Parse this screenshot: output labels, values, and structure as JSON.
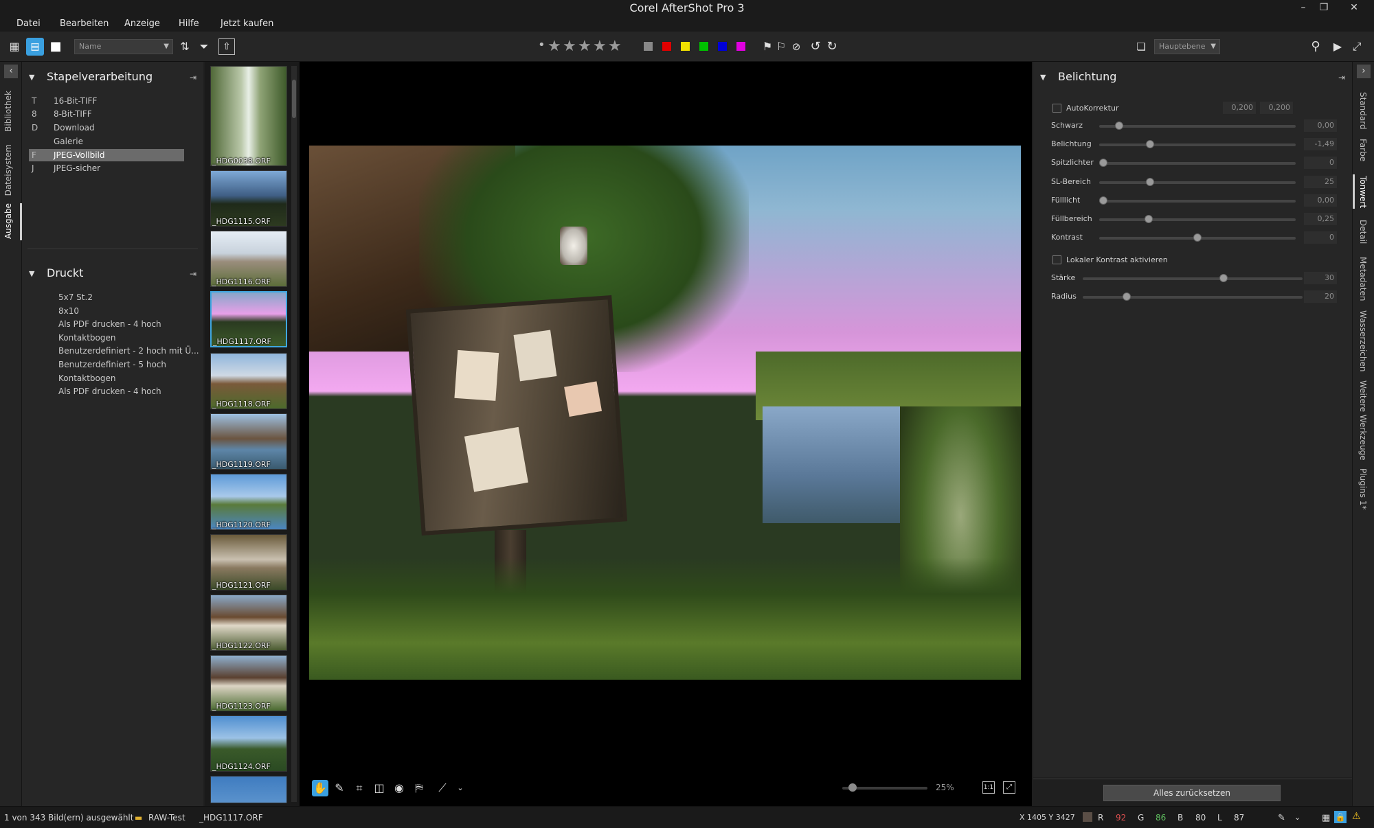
{
  "window": {
    "title": "Corel AfterShot Pro 3",
    "minimize": "–",
    "maximize": "❐",
    "close": "✕"
  },
  "menu": [
    "Datei",
    "Bearbeiten",
    "Anzeige",
    "Hilfe",
    "Jetzt kaufen"
  ],
  "toolbar": {
    "sort_field": "Name",
    "layer_select": "Hauptebene",
    "rating_dot": "•",
    "colors": [
      "#888888",
      "#e00000",
      "#f0e000",
      "#00c000",
      "#0000d8",
      "#e000e0"
    ]
  },
  "left_tabs": [
    "Bibliothek",
    "Dateisystem",
    "Ausgabe"
  ],
  "batch": {
    "title": "Stapelverarbeitung",
    "items": [
      {
        "key": "T",
        "label": "16-Bit-TIFF"
      },
      {
        "key": "8",
        "label": "8-Bit-TIFF"
      },
      {
        "key": "D",
        "label": "Download"
      },
      {
        "key": "",
        "label": "Galerie"
      },
      {
        "key": "F",
        "label": "JPEG-Vollbild"
      },
      {
        "key": "J",
        "label": "JPEG-sicher"
      }
    ]
  },
  "print": {
    "title": "Druckt",
    "items": [
      "5x7 St.2",
      "8x10",
      "Als PDF drucken - 4 hoch",
      "Kontaktbogen",
      "Benutzerdefiniert - 2 hoch mit Ü...",
      "Benutzerdefiniert - 5 hoch",
      "Kontaktbogen",
      "Als PDF drucken - 4 hoch"
    ]
  },
  "thumbnails": [
    "_HDG0038.ORF",
    "_HDG1115.ORF",
    "_HDG1116.ORF",
    "_HDG1117.ORF",
    "_HDG1118.ORF",
    "_HDG1119.ORF",
    "_HDG1120.ORF",
    "_HDG1121.ORF",
    "_HDG1122.ORF",
    "_HDG1123.ORF",
    "_HDG1124.ORF"
  ],
  "adjust": {
    "title": "Belichtung",
    "autokorrektur": "AutoKorrektur",
    "auto_vals": [
      "0,200",
      "0,200"
    ],
    "sliders": [
      {
        "label": "Schwarz",
        "value": "0,00",
        "pos": 0.1
      },
      {
        "label": "Belichtung",
        "value": "-1,49",
        "pos": 0.26
      },
      {
        "label": "Spitzlichter",
        "value": "0",
        "pos": 0.02
      },
      {
        "label": "SL-Bereich",
        "value": "25",
        "pos": 0.26
      },
      {
        "label": "Fülllicht",
        "value": "0,00",
        "pos": 0.02
      },
      {
        "label": "Füllbereich",
        "value": "0,25",
        "pos": 0.25
      },
      {
        "label": "Kontrast",
        "value": "0",
        "pos": 0.5
      }
    ],
    "local_contrast": "Lokaler Kontrast aktivieren",
    "local_sliders": [
      {
        "label": "Stärke",
        "value": "30",
        "pos": 0.64
      },
      {
        "label": "Radius",
        "value": "20",
        "pos": 0.2
      }
    ],
    "reset": "Alles zurücksetzen"
  },
  "right_tabs": [
    "Standard",
    "Farbe",
    "Tonwert",
    "Detail",
    "Metadaten",
    "Wasserzeichen",
    "Weitere Werkzeuge",
    "Plugins 1*"
  ],
  "viewer": {
    "zoom": "25%",
    "zoom_level": 0.12
  },
  "status": {
    "selection": "1 von 343 Bild(ern) ausgewählt",
    "folder": "RAW-Test",
    "file": "_HDG1117.ORF",
    "coords": "X 1405  Y 3427",
    "r_label": "R",
    "r": "92",
    "g_label": "G",
    "g": "86",
    "b_label": "B",
    "b": "80",
    "l_label": "L",
    "l": "87"
  }
}
